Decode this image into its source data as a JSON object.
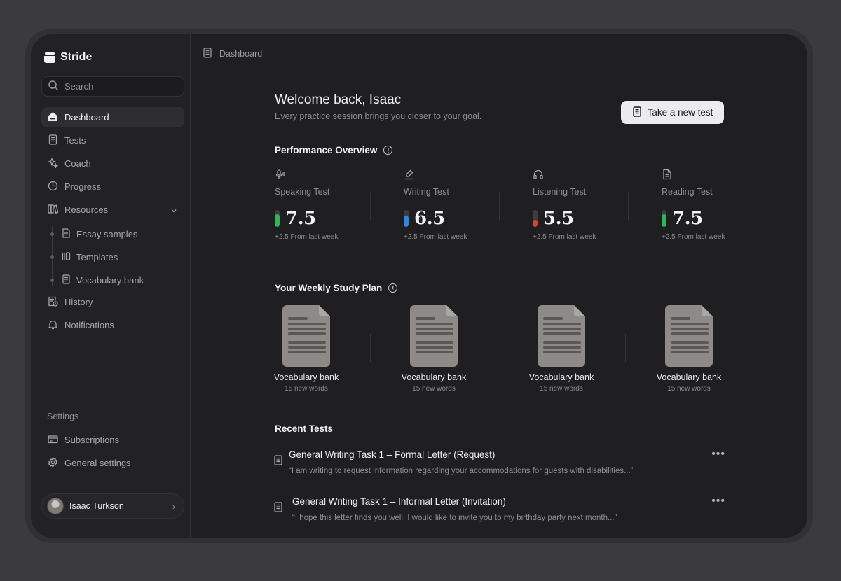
{
  "app": {
    "name": "Stride"
  },
  "search": {
    "placeholder": "Search"
  },
  "sidebar": {
    "items": [
      {
        "label": "Dashboard",
        "icon": "home-icon",
        "active": true
      },
      {
        "label": "Tests",
        "icon": "notebook-icon"
      },
      {
        "label": "Coach",
        "icon": "sparkle-icon"
      },
      {
        "label": "Progress",
        "icon": "pie-chart-icon"
      },
      {
        "label": "Resources",
        "icon": "library-icon",
        "expanded": true
      }
    ],
    "resources": [
      {
        "label": "Essay samples",
        "icon": "file-text-icon"
      },
      {
        "label": "Templates",
        "icon": "templates-icon"
      },
      {
        "label": "Vocabulary bank",
        "icon": "document-icon"
      }
    ],
    "more_items": [
      {
        "label": "History",
        "icon": "history-icon"
      },
      {
        "label": "Notifications",
        "icon": "bell-icon"
      }
    ],
    "settings_title": "Settings",
    "settings_items": [
      {
        "label": "Subscriptions",
        "icon": "credit-card-icon"
      },
      {
        "label": "General settings",
        "icon": "gear-icon"
      }
    ],
    "user": {
      "name": "Isaac Turkson"
    }
  },
  "topbar": {
    "breadcrumb": "Dashboard"
  },
  "welcome": {
    "title": "Welcome back, Isaac",
    "subtitle": "Every practice session brings you closer to your goal.",
    "cta_label": "Take a new test"
  },
  "performance": {
    "title": "Performance Overview",
    "stats": [
      {
        "name": "Speaking Test",
        "value": "7.5",
        "delta": "+2.5 From last week",
        "icon": "microphone-icon",
        "level": 0.75,
        "color": "#2fb45a"
      },
      {
        "name": "Writing Test",
        "value": "6.5",
        "delta": "+2.5 From last week",
        "icon": "pen-icon",
        "level": 0.65,
        "color": "#2f86e4"
      },
      {
        "name": "Listening Test",
        "value": "5.5",
        "delta": "+2.5 From last week",
        "icon": "headphones-icon",
        "level": 0.4,
        "color": "#d8452f"
      },
      {
        "name": "Reading Test",
        "value": "7.5",
        "delta": "+2.5 From last week",
        "icon": "book-icon",
        "level": 0.75,
        "color": "#2fb45a"
      }
    ]
  },
  "study_plan": {
    "title": "Your Weekly Study Plan",
    "items": [
      {
        "name": "Vocabulary bank",
        "count": "15 new words"
      },
      {
        "name": "Vocabulary bank",
        "count": "15 new words"
      },
      {
        "name": "Vocabulary bank",
        "count": "15 new words"
      },
      {
        "name": "Vocabulary bank",
        "count": "15 new words"
      }
    ]
  },
  "recent_tests": {
    "title": "Recent Tests",
    "items": [
      {
        "title": "General Writing Task 1 – Formal Letter (Request)",
        "quote": "“I am writing to request information regarding your accommodations for guests with disabilities...”"
      },
      {
        "title": "General Writing Task 1 – Informal Letter (Invitation)",
        "quote": "“I hope this letter finds you well. I would like to invite you to my birthday party next month...”"
      }
    ]
  }
}
